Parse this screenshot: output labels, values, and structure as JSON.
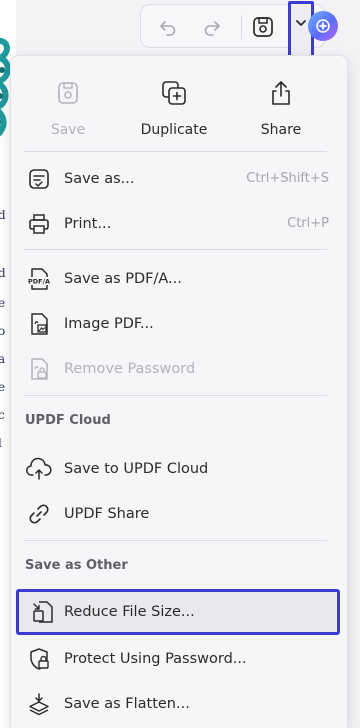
{
  "menu": {
    "quick_actions": [
      {
        "label": "Save",
        "icon": "save-icon",
        "enabled": false
      },
      {
        "label": "Duplicate",
        "icon": "duplicate-icon",
        "enabled": true
      },
      {
        "label": "Share",
        "icon": "share-icon",
        "enabled": true
      }
    ],
    "items": [
      {
        "label": "Save as...",
        "shortcut": "Ctrl+Shift+S",
        "icon": "save-as-icon"
      },
      {
        "label": "Print...",
        "shortcut": "Ctrl+P",
        "icon": "printer-icon"
      },
      {
        "label": "Save as PDF/A...",
        "icon": "pdfa-icon"
      },
      {
        "label": "Image PDF...",
        "icon": "image-pdf-icon"
      },
      {
        "label": "Remove Password",
        "icon": "remove-password-icon",
        "enabled": false
      }
    ],
    "cloud_section": {
      "title": "UPDF Cloud",
      "items": [
        {
          "label": "Save to UPDF Cloud",
          "icon": "cloud-upload-icon"
        },
        {
          "label": "UPDF Share",
          "icon": "link-icon"
        }
      ]
    },
    "other_section": {
      "title": "Save as Other",
      "items": [
        {
          "label": "Reduce File Size...",
          "icon": "reduce-size-icon",
          "highlighted": true
        },
        {
          "label": "Protect Using Password...",
          "icon": "shield-lock-icon"
        },
        {
          "label": "Save as Flatten...",
          "icon": "flatten-layers-icon"
        }
      ]
    }
  },
  "colors": {
    "highlight": "#3d3bcf",
    "disabled_text": "#b3b3b8",
    "shortcut_text": "#a6a6ab"
  }
}
